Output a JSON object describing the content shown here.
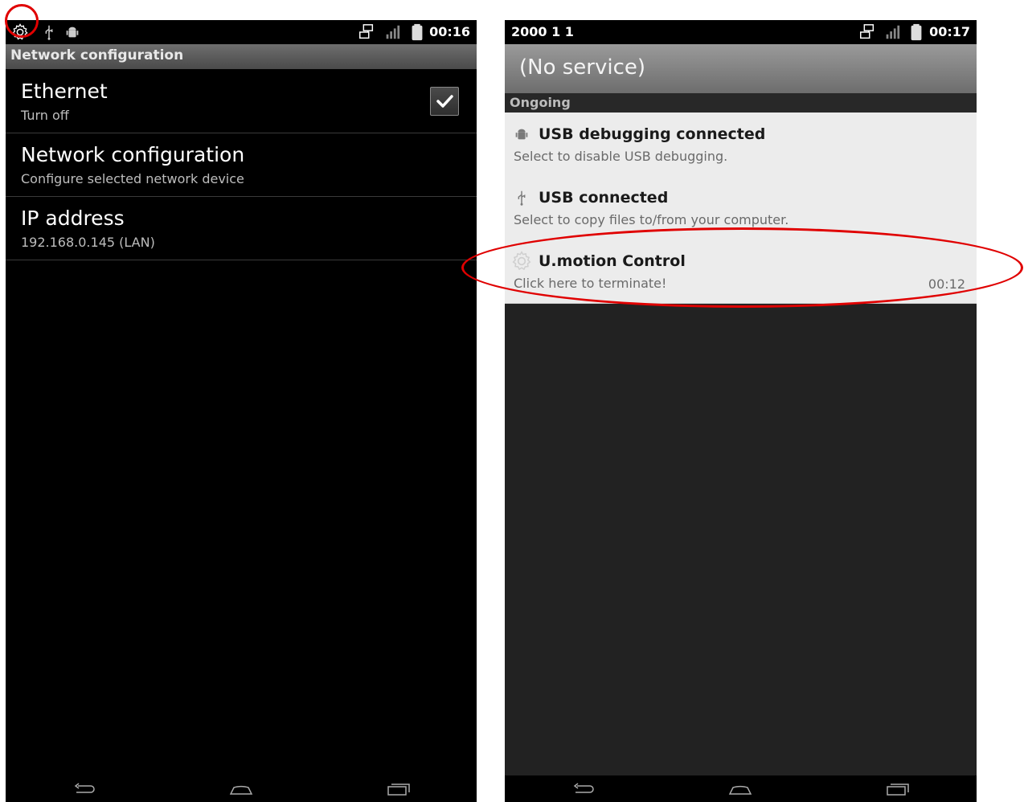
{
  "colors": {
    "annotation": "#e00000",
    "phone_bg": "#000000",
    "shade_bg": "#222222",
    "notification_bg": "#ececec"
  },
  "left_screen": {
    "statusbar": {
      "time": "00:16",
      "icons": [
        "gear-icon",
        "usb-icon",
        "android-debug-icon",
        "ethernet-icon",
        "signal-icon",
        "battery-icon"
      ]
    },
    "title": "Network configuration",
    "items": [
      {
        "title": "Ethernet",
        "summary": "Turn off",
        "checked": true
      },
      {
        "title": "Network configuration",
        "summary": "Configure selected network device"
      },
      {
        "title": "IP address",
        "summary": "192.168.0.145 (LAN)"
      }
    ],
    "navbar": [
      "back-icon",
      "home-icon",
      "recent-apps-icon"
    ]
  },
  "right_screen": {
    "statusbar": {
      "date": "2000 1 1",
      "time": "00:17",
      "icons": [
        "ethernet-icon",
        "signal-icon",
        "battery-icon"
      ]
    },
    "carrier": "(No service)",
    "section_label": "Ongoing",
    "notifications": [
      {
        "icon": "android-debug-icon",
        "title": "USB debugging connected",
        "text": "Select to disable USB debugging.",
        "time": ""
      },
      {
        "icon": "usb-icon",
        "title": "USB connected",
        "text": "Select to copy files to/from your computer.",
        "time": ""
      },
      {
        "icon": "gear-icon",
        "title": "U.motion Control",
        "text": "Click here to terminate!",
        "time": "00:12"
      }
    ],
    "navbar": [
      "back-icon",
      "home-icon",
      "recent-apps-icon"
    ]
  }
}
